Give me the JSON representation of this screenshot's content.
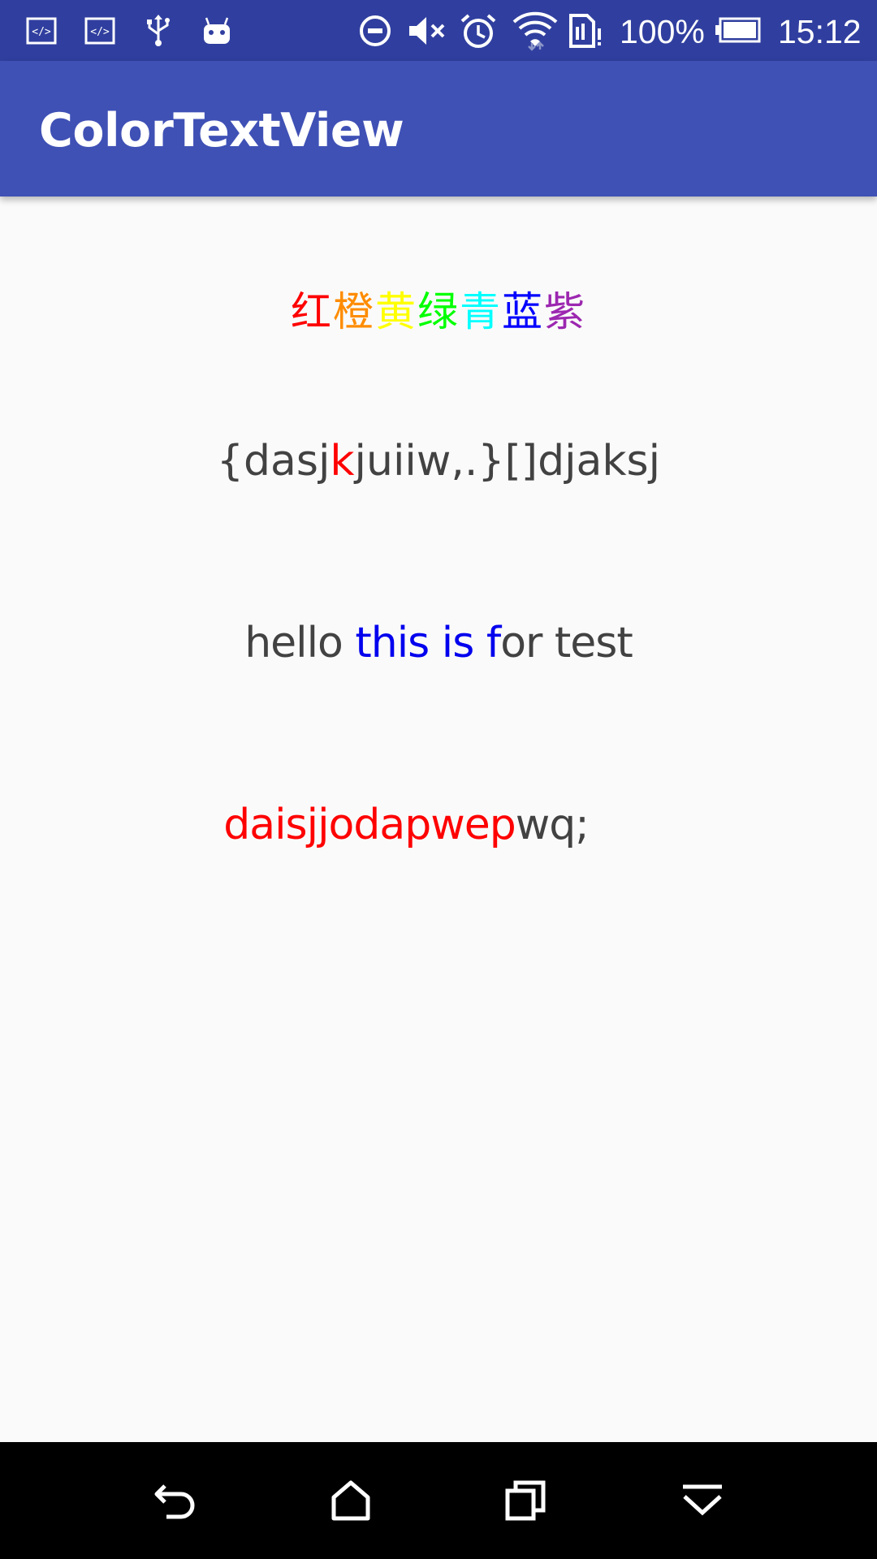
{
  "status_bar": {
    "battery_percent": "100%",
    "time": "15:12",
    "icons": [
      "code-icon",
      "code-icon",
      "usb-icon",
      "android-icon",
      "do-not-disturb-icon",
      "mute-icon",
      "alarm-icon",
      "wifi-icon",
      "sim-icon",
      "battery-icon"
    ]
  },
  "app_bar": {
    "title": "ColorTextView"
  },
  "content": {
    "line1": [
      {
        "text": "红",
        "color": "#ff0000"
      },
      {
        "text": "橙",
        "color": "#ff8c00"
      },
      {
        "text": "黄",
        "color": "#ffff00"
      },
      {
        "text": "绿",
        "color": "#00ff00"
      },
      {
        "text": "青",
        "color": "#00ffff"
      },
      {
        "text": "蓝",
        "color": "#0000ff"
      },
      {
        "text": "紫",
        "color": "#9c27b0"
      }
    ],
    "line2": [
      {
        "text": "{dasj",
        "color": "#424242"
      },
      {
        "text": "k",
        "color": "#ff0000"
      },
      {
        "text": "juiiw,.}[]djaksj",
        "color": "#424242"
      }
    ],
    "line3": [
      {
        "text": "hello ",
        "color": "#424242"
      },
      {
        "text": "this is f",
        "color": "#0000ee"
      },
      {
        "text": "or test",
        "color": "#424242"
      }
    ],
    "line4": [
      {
        "text": "daisjjodapwep",
        "color": "#ff0000"
      },
      {
        "text": "wq;",
        "color": "#424242"
      }
    ]
  },
  "nav_bar": {
    "buttons": [
      "back-icon",
      "home-icon",
      "recents-icon",
      "notifications-icon"
    ]
  }
}
